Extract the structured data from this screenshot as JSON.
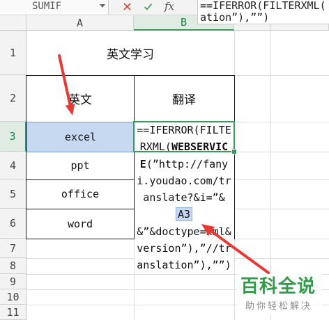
{
  "toolbar": {
    "name_box": "SUMIF",
    "name_box_icon": "chevron-down-icon",
    "cancel_icon": "close-icon",
    "confirm_icon": "check-icon",
    "fx_label": "fx",
    "formula_lines": [
      "==IFERROR(FILTERXML(",
      "ation”),””)"
    ]
  },
  "sheet": {
    "column_headers": [
      "A",
      "B"
    ],
    "row_headers": [
      "1",
      "2",
      "3",
      "4",
      "5",
      "6",
      "7",
      "8",
      "9",
      "10",
      "11"
    ],
    "cells": {
      "A1": "英文学习",
      "A2": "英文",
      "B2": "翻译",
      "A3": "excel",
      "A4": "ppt",
      "A5": "office",
      "A6": "word"
    }
  },
  "editor": {
    "lines": [
      [
        "==IFERROR(FILTE"
      ],
      [
        "RXML(",
        "WEBSERVIC"
      ],
      [
        "E",
        "(”http://fany"
      ],
      [
        "i.youdao.com/tr"
      ],
      [
        "anslate?&i=”&"
      ],
      [
        "A3"
      ],
      [
        "&”&doctype=xml&"
      ],
      [
        "version”),”//tr"
      ],
      [
        "anslation”),””)"
      ]
    ]
  },
  "watermark": {
    "title": "百科全说",
    "subtitle": "助你轻松解决"
  },
  "colors": {
    "active_cell_border": "#3a9a5c",
    "active_header_text": "#23834a",
    "active_header_bg": "#e0ebe3",
    "reference_highlight": "#c7d9f1",
    "annotation_arrow": "#e63b34",
    "watermark_green": "#2f9c48",
    "cancel_red": "#d0463e",
    "confirm_green": "#3f9a5c"
  }
}
